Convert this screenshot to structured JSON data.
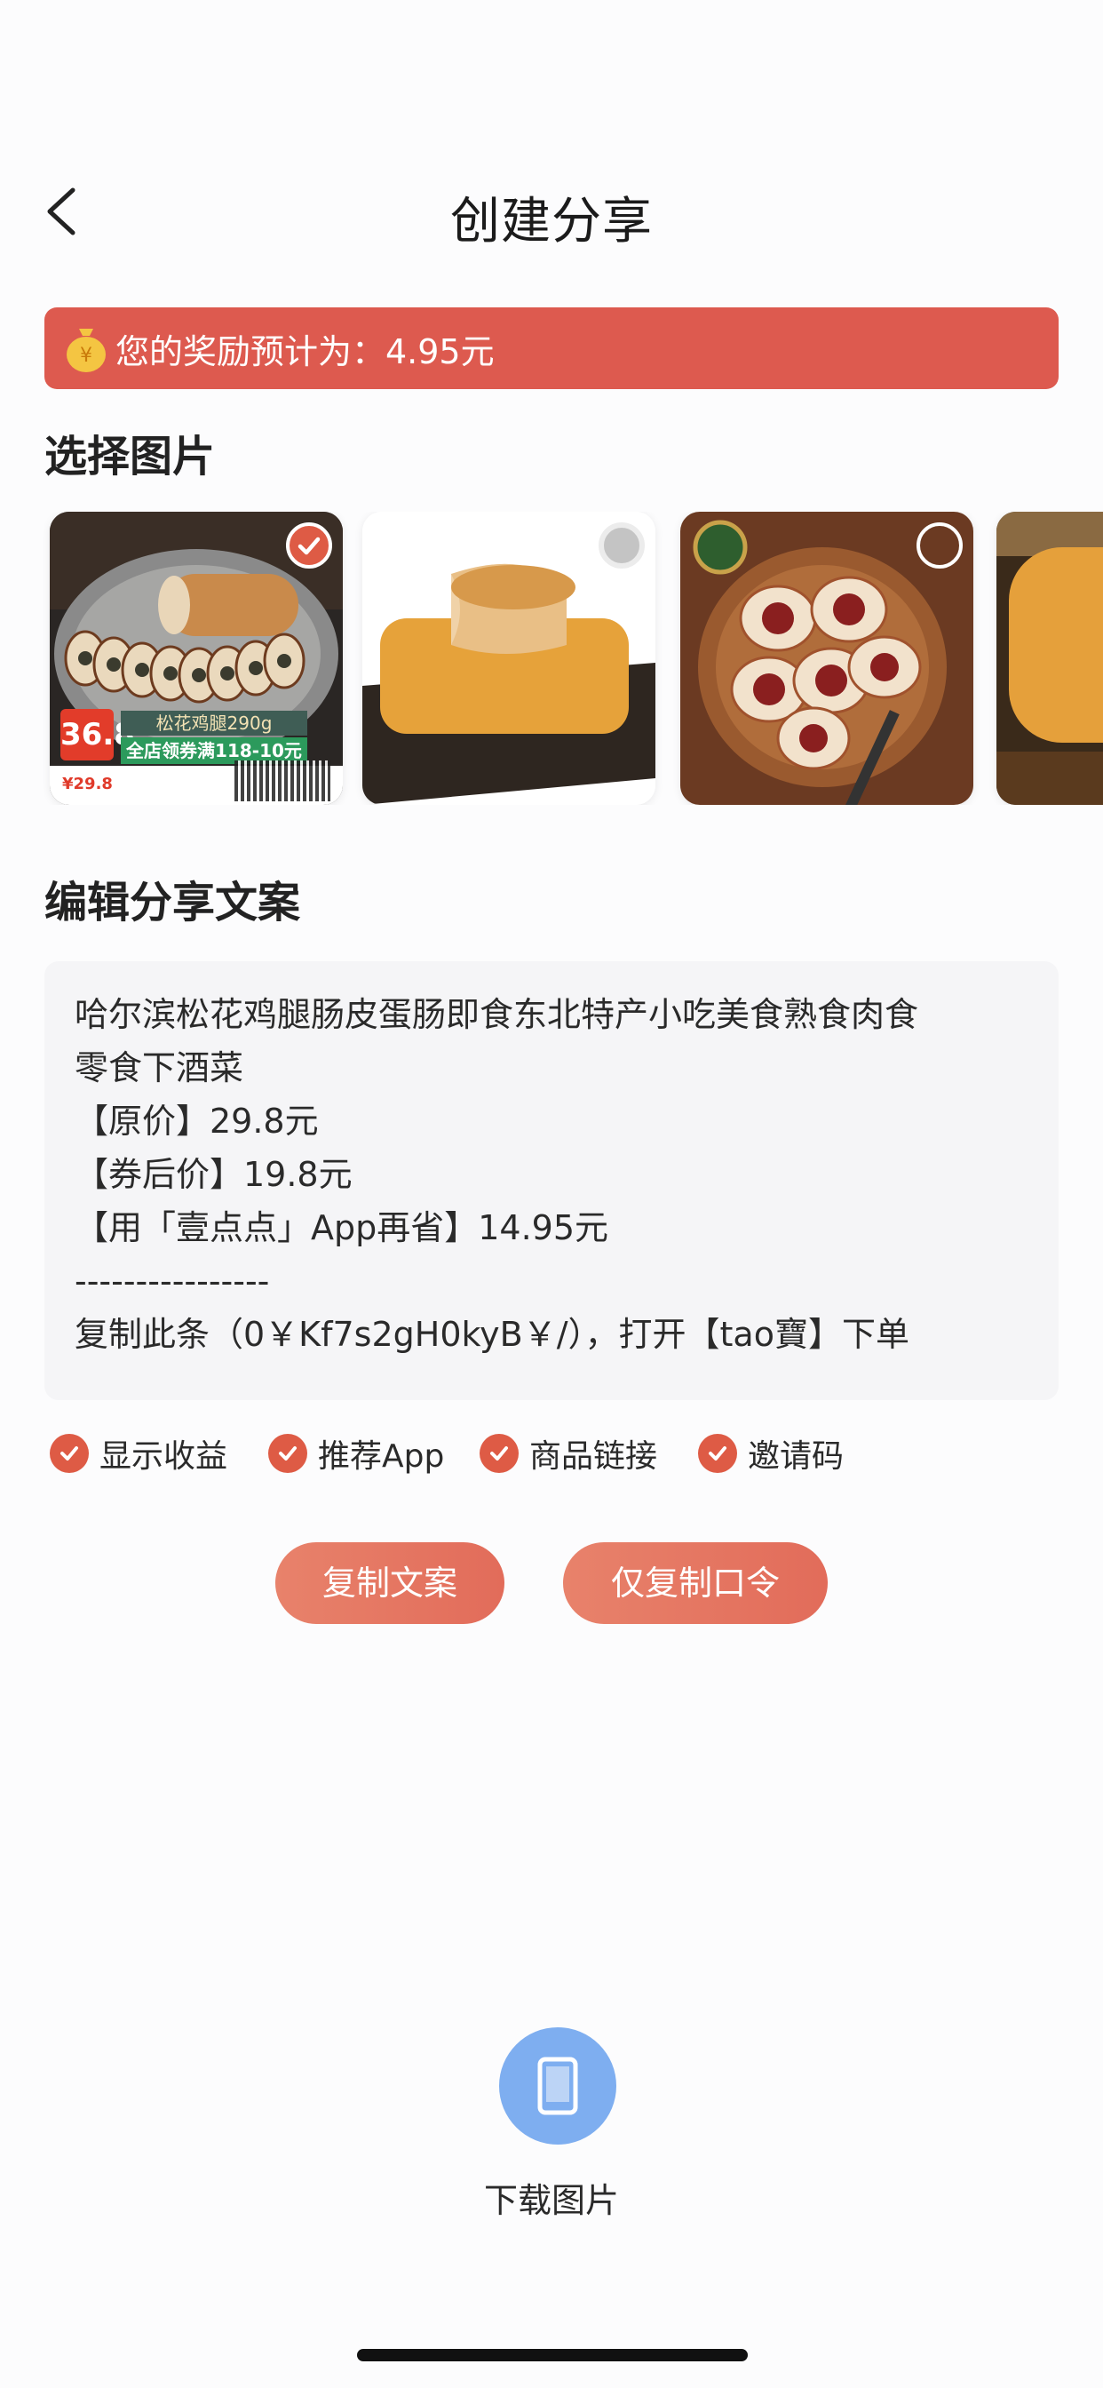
{
  "nav": {
    "title": "创建分享"
  },
  "reward": {
    "text": "您的奖励预计为：4.95元"
  },
  "sections": {
    "choose_image": "选择图片",
    "edit_copy": "编辑分享文案"
  },
  "images": [
    {
      "state": "checked",
      "price_big": "36.8",
      "label": "松花鸡腿290g",
      "promo": "全店领券满118-10元",
      "orig_price": "¥29.8"
    },
    {
      "state": "grey"
    },
    {
      "state": "empty"
    },
    {
      "state": "none"
    }
  ],
  "copy_text": {
    "lines": [
      "哈尔滨松花鸡腿肠皮蛋肠即食东北特产小吃美食熟食肉食",
      "零食下酒菜",
      "【原价】29.8元",
      "【券后价】19.8元",
      "【用「壹点点」App再省】14.95元",
      "----------------",
      "复制此条（0￥Kf7s2gH0kyB￥/），打开【tao寶】下单"
    ]
  },
  "options": [
    {
      "label": "显示收益",
      "checked": true
    },
    {
      "label": "推荐App",
      "checked": true
    },
    {
      "label": "商品链接",
      "checked": true
    },
    {
      "label": "邀请码",
      "checked": true
    }
  ],
  "buttons": {
    "copy_text": "复制文案",
    "copy_code": "仅复制口令"
  },
  "download": {
    "label": "下载图片"
  },
  "colors": {
    "accent": "#dd5a4f",
    "button": "#e5786a",
    "download": "#7eaef0"
  }
}
